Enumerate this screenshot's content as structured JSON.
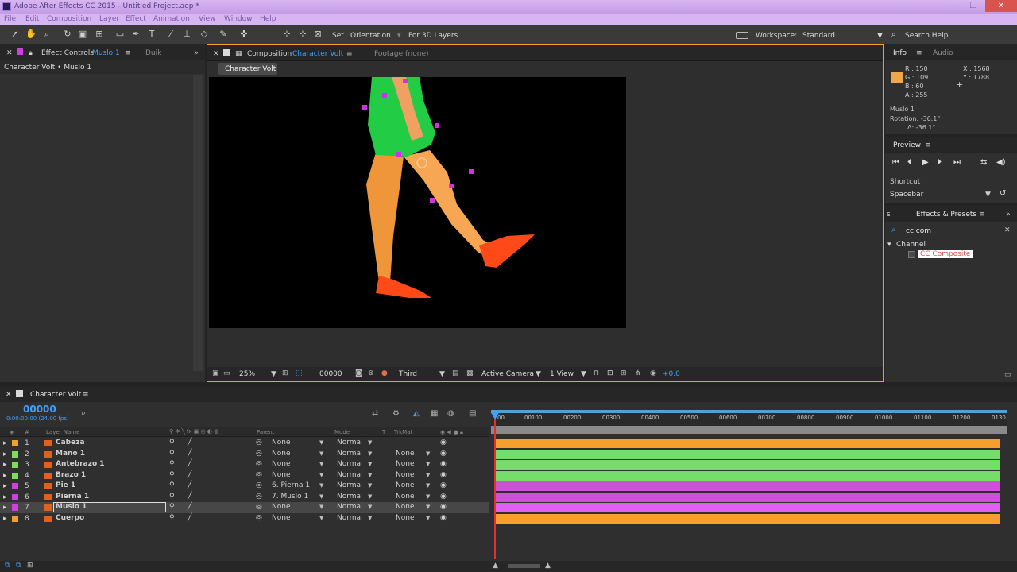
{
  "window": {
    "title": "Adobe After Effects CC 2015 - Untitled Project.aep *",
    "controls": [
      "—",
      "❐",
      "✕"
    ]
  },
  "menu": [
    "File",
    "Edit",
    "Composition",
    "Layer",
    "Effect",
    "Animation",
    "View",
    "Window",
    "Help"
  ],
  "toolbar": {
    "set_label": "Set",
    "orientation_label": "Orientation",
    "for3d_label": "For 3D Layers",
    "workspace_label": "Workspace:",
    "workspace_value": "Standard",
    "search_help": "Search Help"
  },
  "effect_controls": {
    "tab_label": "Effect Controls",
    "tab_layer": "Muslo 1",
    "tab_duik": "Duik",
    "breadcrumb": "Character Volt • Muslo 1"
  },
  "composition": {
    "tab_label": "Composition",
    "tab_comp": "Character Volt",
    "footage_tab": "Footage (none)",
    "subtab": "Character Volt"
  },
  "viewer_footer": {
    "zoom": "25%",
    "timecode": "00000",
    "resolution": "Third",
    "camera": "Active Camera",
    "views": "1 View",
    "exposure": "+0.0"
  },
  "info": {
    "tab_info": "Info",
    "tab_audio": "Audio",
    "r": "R : 150",
    "g": "G : 109",
    "b": "B : 60",
    "a": "A : 255",
    "x": "X : 1568",
    "y": "Y : 1788",
    "layer": "Muslo 1",
    "rotation": "Rotation: -36.1°",
    "delta": "Δ: -36.1°",
    "swatch_color": "#f2a64a"
  },
  "preview": {
    "title": "Preview",
    "shortcut_label": "Shortcut",
    "shortcut_value": "Spacebar"
  },
  "effects_presets": {
    "title": "Effects & Presets",
    "search_value": "cc com",
    "category": "Channel",
    "item": "CC Composite"
  },
  "timeline": {
    "comp_tab": "Character Volt",
    "timecode": "00000",
    "fps": "0:00:00:00 (24.00 fps)",
    "col_layer_name": "Layer Name",
    "col_parent": "Parent",
    "col_mode": "Mode",
    "col_t": "T",
    "col_trkmat": "TrkMat",
    "ruler": [
      "00",
      "00100",
      "00200",
      "00300",
      "00400",
      "00500",
      "00600",
      "00700",
      "00800",
      "00900",
      "01000",
      "01100",
      "01200",
      "0130"
    ],
    "layers": [
      {
        "num": "1",
        "name": "Cabeza",
        "label_color": "#f0a030",
        "parent": "None",
        "mode": "Normal",
        "trkmat": "",
        "bar_color": "#f5a02c"
      },
      {
        "num": "2",
        "name": "Mano 1",
        "label_color": "#7ddc5a",
        "parent": "None",
        "mode": "Normal",
        "trkmat": "None",
        "bar_color": "#76dd6a"
      },
      {
        "num": "3",
        "name": "Antebrazo 1",
        "label_color": "#7ddc5a",
        "parent": "None",
        "mode": "Normal",
        "trkmat": "None",
        "bar_color": "#76dd6a"
      },
      {
        "num": "4",
        "name": "Brazo 1",
        "label_color": "#7ddc5a",
        "parent": "None",
        "mode": "Normal",
        "trkmat": "None",
        "bar_color": "#76dd6a"
      },
      {
        "num": "5",
        "name": "Pie 1",
        "label_color": "#d040e0",
        "parent": "6. Pierna 1",
        "mode": "Normal",
        "trkmat": "None",
        "bar_color": "#cc50d8"
      },
      {
        "num": "6",
        "name": "Pierna 1",
        "label_color": "#d040e0",
        "parent": "7. Muslo 1",
        "mode": "Normal",
        "trkmat": "None",
        "bar_color": "#cc50d8"
      },
      {
        "num": "7",
        "name": "Muslo 1",
        "label_color": "#d040e0",
        "parent": "None",
        "mode": "Normal",
        "trkmat": "None",
        "bar_color": "#e060f0"
      },
      {
        "num": "8",
        "name": "Cuerpo",
        "label_color": "#f0a030",
        "parent": "None",
        "mode": "Normal",
        "trkmat": "None",
        "bar_color": "#f5a02c"
      }
    ]
  }
}
